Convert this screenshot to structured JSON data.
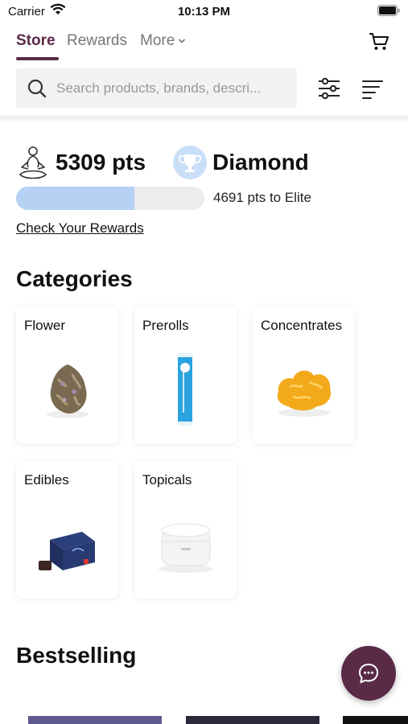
{
  "status_bar": {
    "carrier": "Carrier",
    "time": "10:13 PM"
  },
  "nav": {
    "tabs": [
      {
        "label": "Store",
        "active": true
      },
      {
        "label": "Rewards",
        "active": false
      },
      {
        "label": "More",
        "active": false
      }
    ]
  },
  "search": {
    "placeholder": "Search products, brands, descri..."
  },
  "rewards": {
    "points": "5309 pts",
    "tier": "Diamond",
    "progress": 0.63,
    "to_next": "4691 pts to Elite",
    "link": "Check Your Rewards"
  },
  "categories": {
    "title": "Categories",
    "items": [
      {
        "label": "Flower",
        "icon": "flower-image"
      },
      {
        "label": "Prerolls",
        "icon": "preroll-image"
      },
      {
        "label": "Concentrates",
        "icon": "concentrate-image"
      },
      {
        "label": "Edibles",
        "icon": "edibles-image"
      },
      {
        "label": "Topicals",
        "icon": "topicals-image"
      }
    ]
  },
  "bestselling": {
    "title": "Bestselling"
  },
  "colors": {
    "brand": "#5a2a47",
    "progress_fill": "#b5d1f3",
    "tier_badge": "#c9dff7"
  }
}
